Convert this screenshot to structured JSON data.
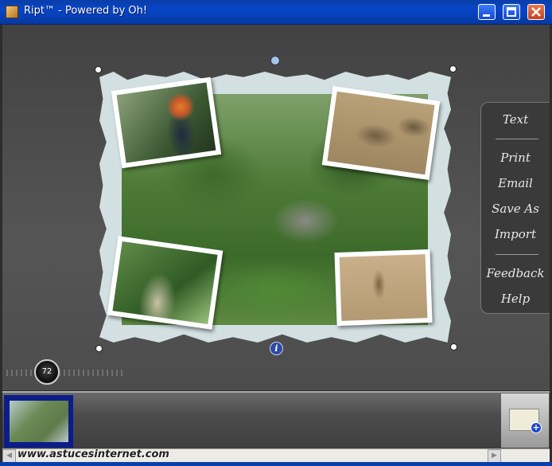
{
  "window": {
    "title": "Ript™ - Powered by Oh!"
  },
  "side_menu": {
    "items": [
      "Text",
      "Print",
      "Email",
      "Save As",
      "Import",
      "Feedback",
      "Help"
    ]
  },
  "zoom": {
    "value": "72"
  },
  "info_icon": {
    "glyph": "i"
  },
  "tray": {
    "add_glyph": "+"
  },
  "watermark": {
    "text": "www.astucesinternet.com"
  },
  "colors": {
    "titlebar": "#0846c8",
    "stage": "#4a4a4a",
    "panel": "#3a3a3a",
    "thumb_selection": "#0c1d8a"
  }
}
